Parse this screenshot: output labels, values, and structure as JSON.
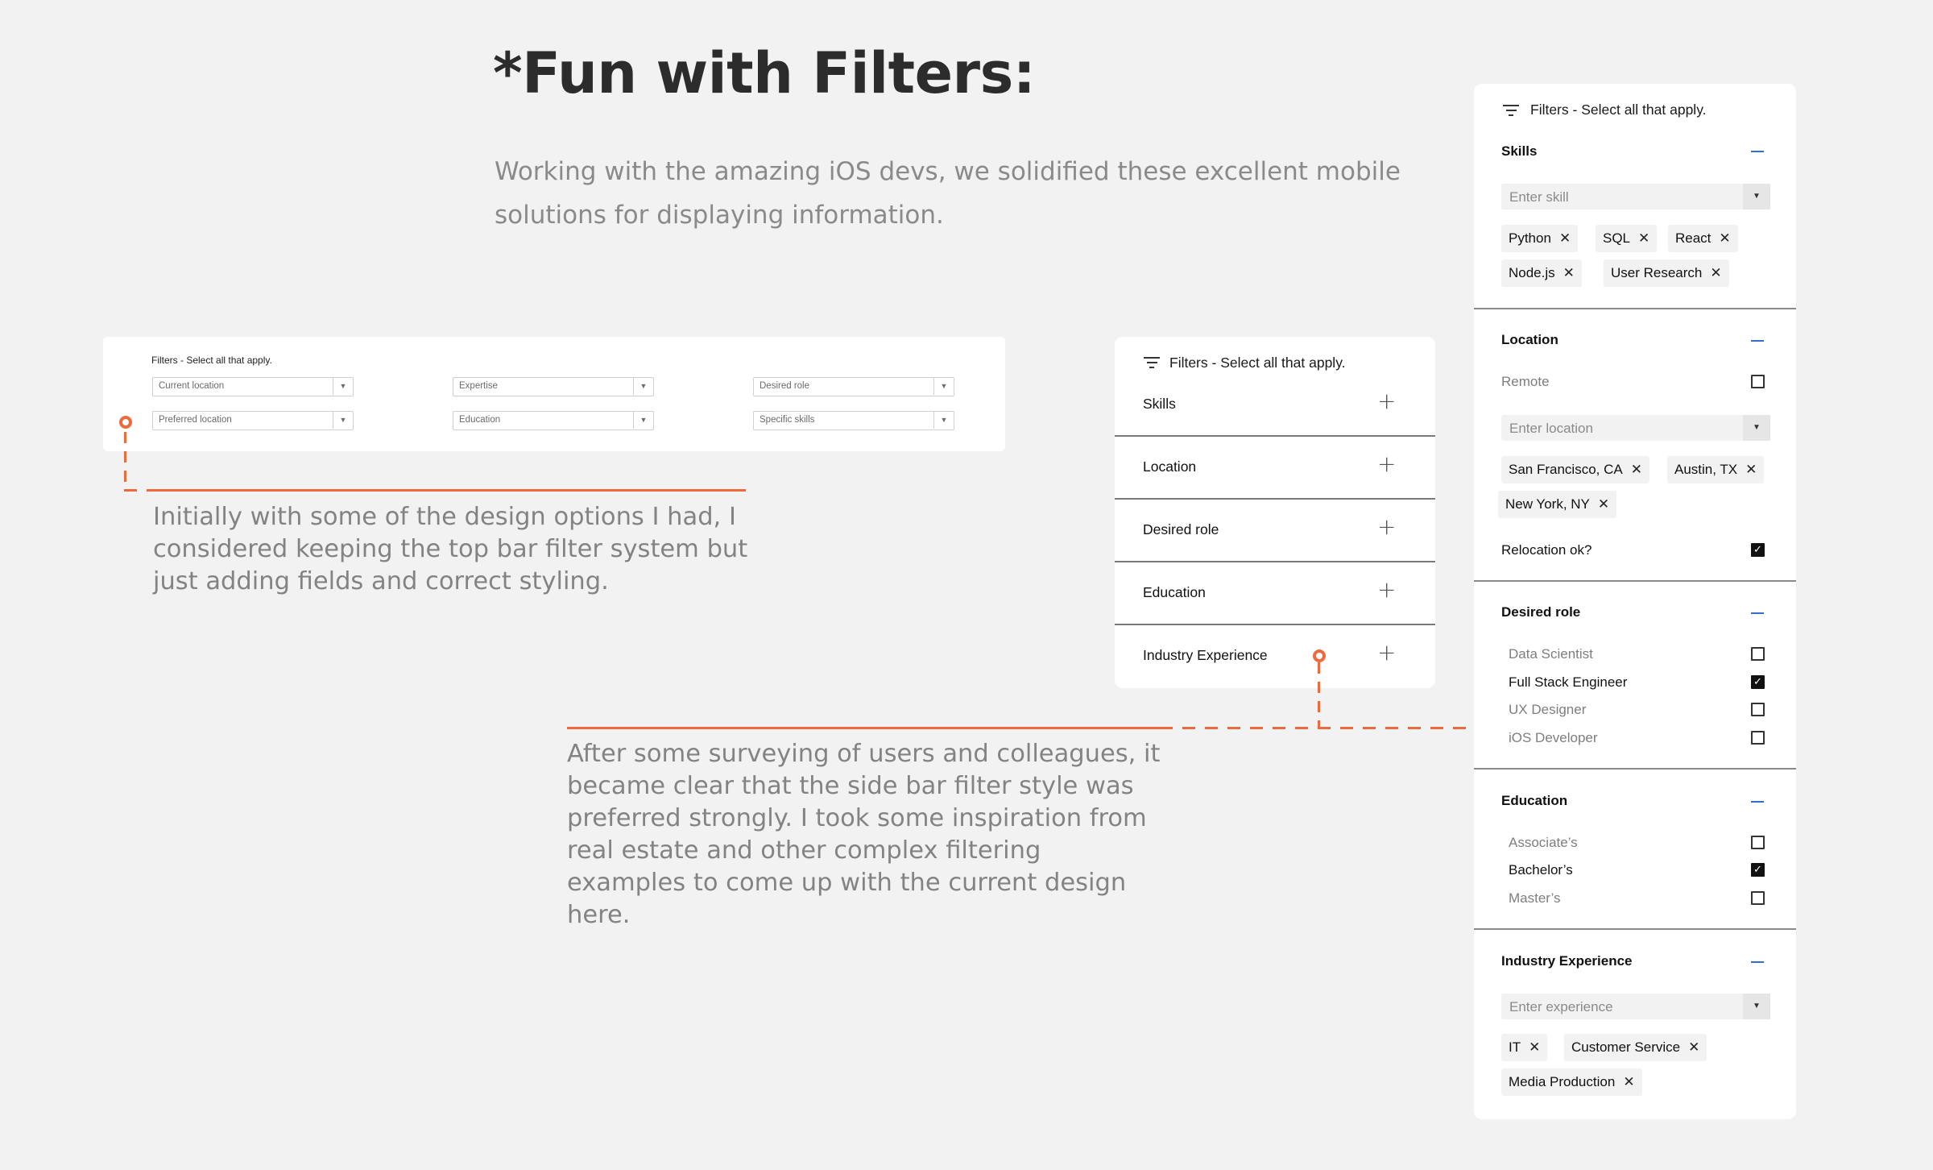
{
  "heading": "*Fun with Filters:",
  "subheading": "Working with the amazing iOS devs, we solidified these excellent mobile solutions for displaying information.",
  "note_topbar": "Initially with some of the design options I had, I considered keeping the top bar filter system but just adding fields and correct styling.",
  "note_sidebar": "After some surveying of users and colleagues, it became clear that the side bar filter style was preferred strongly. I took some inspiration from real estate and other complex filtering examples to come up with the current design here.",
  "topbar": {
    "title": "Filters - Select all that apply.",
    "selects": [
      "Current location",
      "Expertise",
      "Desired role",
      "Preferred location",
      "Education",
      "Specific skills"
    ]
  },
  "sidebar_collapsed": {
    "title": "Filters - Select all that apply.",
    "sections": [
      "Skills",
      "Location",
      "Desired role",
      "Education",
      "Industry Experience"
    ]
  },
  "sidebar_expanded": {
    "title": "Filters - Select all that apply.",
    "skills": {
      "title": "Skills",
      "placeholder": "Enter  skill",
      "chips": [
        "Python",
        "SQL",
        "React",
        "Node.js",
        "User Research"
      ]
    },
    "location": {
      "title": "Location",
      "remote_label": "Remote",
      "remote_checked": false,
      "placeholder": "Enter  location",
      "chips": [
        "San Francisco, CA",
        "Austin, TX",
        "New York, NY"
      ],
      "relocation_label": "Relocation ok?",
      "relocation_checked": true
    },
    "desired_role": {
      "title": "Desired role",
      "options": [
        {
          "label": "Data Scientist",
          "checked": false
        },
        {
          "label": "Full Stack Engineer",
          "checked": true
        },
        {
          "label": "UX Designer",
          "checked": false
        },
        {
          "label": "iOS Developer",
          "checked": false
        }
      ]
    },
    "education": {
      "title": "Education",
      "options": [
        {
          "label": "Associate’s",
          "checked": false
        },
        {
          "label": "Bachelor’s",
          "checked": true
        },
        {
          "label": "Master’s",
          "checked": false
        }
      ]
    },
    "industry": {
      "title": "Industry Experience",
      "placeholder": "Enter  experience",
      "chips": [
        "IT",
        "Customer Service",
        "Media Production"
      ]
    }
  },
  "icons": {
    "filter": "filter-icon",
    "plus": "plus-icon",
    "minus": "minus-icon",
    "close": "close-icon",
    "dropdown": "caret-down-icon",
    "check": "checkmark-icon"
  },
  "colors": {
    "accent_orange": "#ec6a3c",
    "minus_blue": "#2f6fd1",
    "background": "#f2f2f2"
  }
}
